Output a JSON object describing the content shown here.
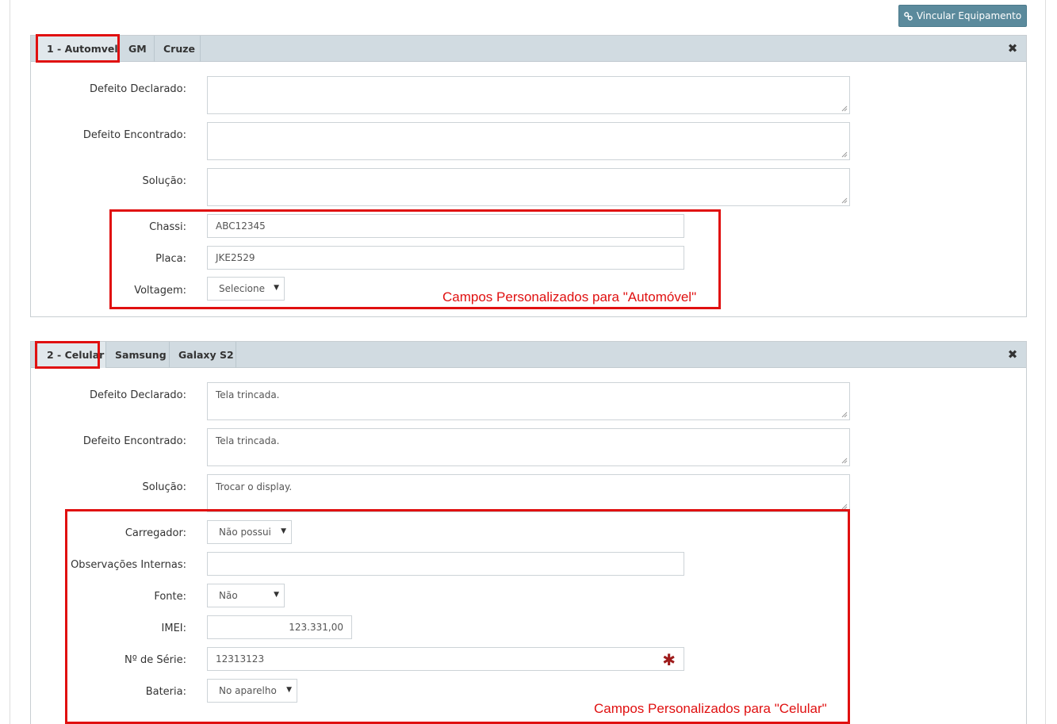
{
  "toolbar": {
    "link_button_label": "Vincular Equipamento",
    "link_icon": "link-icon"
  },
  "panel1": {
    "tabs": [
      "1 - Automvel",
      "GM",
      "Cruze"
    ],
    "close_icon": "close-icon",
    "close_glyph": "✖",
    "fields": {
      "defeito_declarado": {
        "label": "Defeito Declarado:",
        "value": ""
      },
      "defeito_encontrado": {
        "label": "Defeito Encontrado:",
        "value": ""
      },
      "solucao": {
        "label": "Solução:",
        "value": ""
      },
      "chassi": {
        "label": "Chassi:",
        "value": "ABC12345"
      },
      "placa": {
        "label": "Placa:",
        "value": "JKE2529"
      },
      "voltagem": {
        "label": "Voltagem:",
        "value": "Selecione"
      }
    },
    "note": "Campos Personalizados para \"Automóvel\""
  },
  "panel2": {
    "tabs": [
      "2 - Celular",
      "Samsung",
      "Galaxy S2"
    ],
    "close_icon": "close-icon",
    "close_glyph": "✖",
    "fields": {
      "defeito_declarado": {
        "label": "Defeito Declarado:",
        "value": "Tela trincada."
      },
      "defeito_encontrado": {
        "label": "Defeito Encontrado:",
        "value": "Tela trincada."
      },
      "solucao": {
        "label": "Solução:",
        "value": "Trocar o display."
      },
      "carregador": {
        "label": "Carregador:",
        "value": "Não possui"
      },
      "observacoes": {
        "label": "Observações Internas:",
        "value": ""
      },
      "fonte": {
        "label": "Fonte:",
        "value": "Não"
      },
      "imei": {
        "label": "IMEI:",
        "value": "123.331,00"
      },
      "serie": {
        "label": "Nº de Série:",
        "value": "12313123",
        "required_mark": "✱"
      },
      "bateria": {
        "label": "Bateria:",
        "value": "No aparelho"
      }
    },
    "note": "Campos Personalizados para \"Celular\""
  },
  "colors": {
    "accent_button": "#5b8a9c",
    "highlight_red": "#e01010",
    "panel_header": "#d1dbe1",
    "required": "#9e1b1b"
  },
  "arrow_glyph": "▼"
}
